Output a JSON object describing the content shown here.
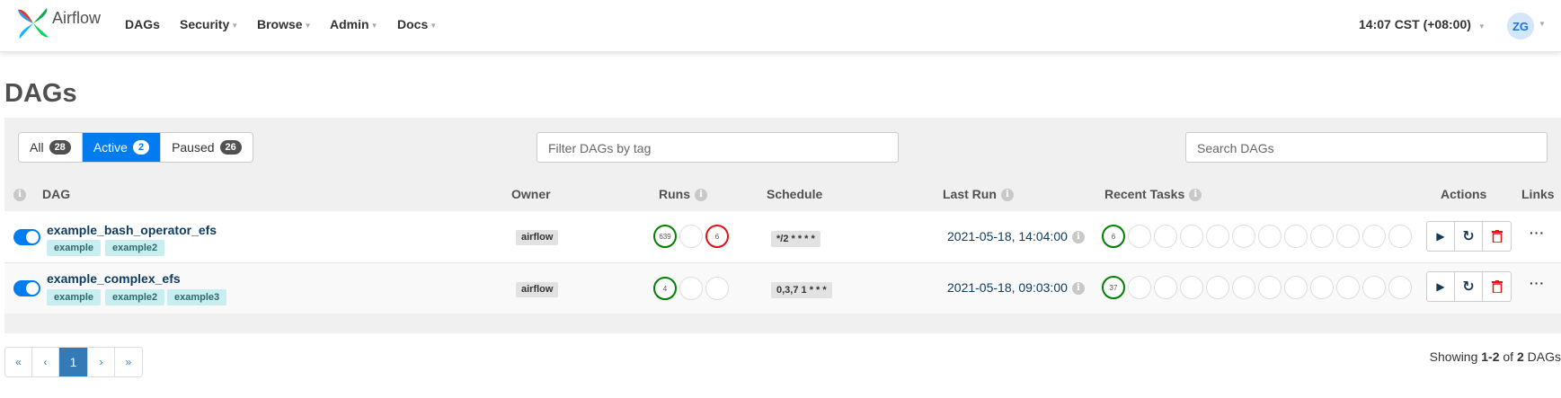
{
  "nav": {
    "brand": "Airflow",
    "items": [
      "DAGs",
      "Security",
      "Browse",
      "Admin",
      "Docs"
    ],
    "clock": "14:07 CST (+08:00)",
    "avatar": "ZG"
  },
  "page_title": "DAGs",
  "status_filter": [
    {
      "label": "All",
      "count": "28"
    },
    {
      "label": "Active",
      "count": "2"
    },
    {
      "label": "Paused",
      "count": "26"
    }
  ],
  "tag_filter_placeholder": "Filter DAGs by tag",
  "search_placeholder": "Search DAGs",
  "columns": {
    "dag": "DAG",
    "owner": "Owner",
    "runs": "Runs",
    "schedule": "Schedule",
    "last_run": "Last Run",
    "recent_tasks": "Recent Tasks",
    "actions": "Actions",
    "links": "Links"
  },
  "dags": [
    {
      "name": "example_bash_operator_efs",
      "tags": [
        "example",
        "example2"
      ],
      "owner": "airflow",
      "runs": [
        "639",
        "",
        "6"
      ],
      "schedule": "*/2 * * * *",
      "last_run": "2021-05-18, 14:04:00",
      "recent_tasks_count": "6"
    },
    {
      "name": "example_complex_efs",
      "tags": [
        "example",
        "example2",
        "example3"
      ],
      "owner": "airflow",
      "runs": [
        "4",
        "",
        ""
      ],
      "schedule": "0,3,7 1 * * *",
      "last_run": "2021-05-18, 09:03:00",
      "recent_tasks_count": "37"
    }
  ],
  "info_glyph": "i",
  "links_glyph": "···",
  "pagination": [
    "«",
    "‹",
    "1",
    "›",
    "»"
  ],
  "showing": {
    "prefix": "Showing ",
    "range": "1-2",
    "mid": " of ",
    "total": "2",
    "suffix": " DAGs"
  },
  "colors": {
    "accent": "#017cee",
    "success": "#008000",
    "failed": "#e01414",
    "tag_bg": "#c9eeef"
  }
}
